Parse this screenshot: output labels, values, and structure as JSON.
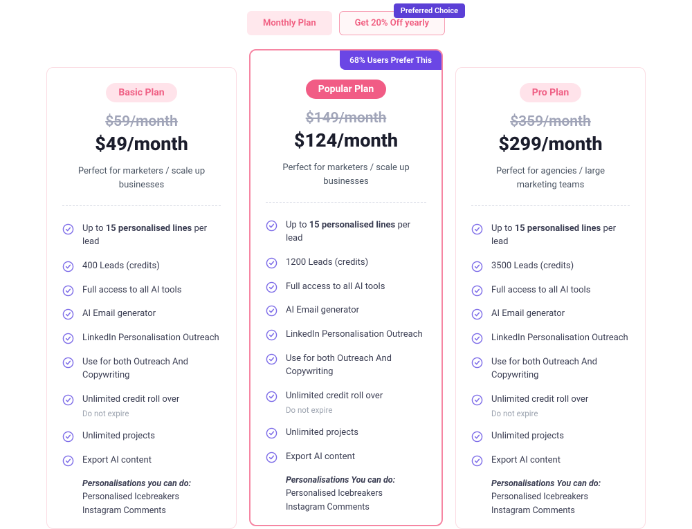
{
  "toggle": {
    "monthly": "Monthly Plan",
    "yearly": "Get 20% Off yearly",
    "preferred_badge": "Preferred Choice"
  },
  "plans": [
    {
      "key": "basic",
      "badge": "Basic Plan",
      "old_price": "$59/month",
      "new_price": "$49/month",
      "desc": "Perfect for marketers / scale up businesses",
      "f0_pre": "Up to ",
      "f0_bold": "15 personalised lines",
      "f0_post": " per lead",
      "f1": "400 Leads (credits)",
      "f2": "Full access to all AI tools",
      "f3": "AI Email generator",
      "f4": "LinkedIn Personalisation Outreach",
      "f5": "Use for both Outreach And Copywriting",
      "f6": "Unlimited credit roll over",
      "f6_sub": "Do not expire",
      "f7": "Unlimited projects",
      "f8": "Export AI content",
      "pers_title": "Personalisations you can do:",
      "pers_1": "Personalised Icebreakers",
      "pers_2": "Instagram Comments"
    },
    {
      "key": "popular",
      "ribbon": "68% Users Prefer This",
      "badge": "Popular Plan",
      "old_price": "$149/month",
      "new_price": "$124/month",
      "desc": "Perfect for marketers / scale up businesses",
      "f0_pre": "Up to ",
      "f0_bold": "15 personalised lines",
      "f0_post": " per lead",
      "f1": "1200 Leads (credits)",
      "f2": "Full access to all AI tools",
      "f3": "AI Email generator",
      "f4": "LinkedIn Personalisation Outreach",
      "f5": "Use for both Outreach And Copywriting",
      "f6": "Unlimited credit roll over",
      "f6_sub": "Do not expire",
      "f7": "Unlimited projects",
      "f8": "Export AI content",
      "pers_title": "Personalisations You can do:",
      "pers_1": "Personalised Icebreakers",
      "pers_2": "Instagram Comments"
    },
    {
      "key": "pro",
      "badge": "Pro Plan",
      "old_price": "$359/month",
      "new_price": "$299/month",
      "desc": "Perfect for agencies / large marketing teams",
      "f0_pre": "Up to ",
      "f0_bold": "15 personalised lines",
      "f0_post": " per lead",
      "f1": "3500 Leads (credits)",
      "f2": "Full access to all AI tools",
      "f3": "AI Email generator",
      "f4": "LinkedIn Personalisation Outreach",
      "f5": "Use for both Outreach And Copywriting",
      "f6": "Unlimited credit roll over",
      "f6_sub": "Do not expire",
      "f7": "Unlimited projects",
      "f8": "Export AI content",
      "pers_title": "Personalisations You can do:",
      "pers_1": "Personalised Icebreakers",
      "pers_2": "Instagram Comments"
    }
  ]
}
